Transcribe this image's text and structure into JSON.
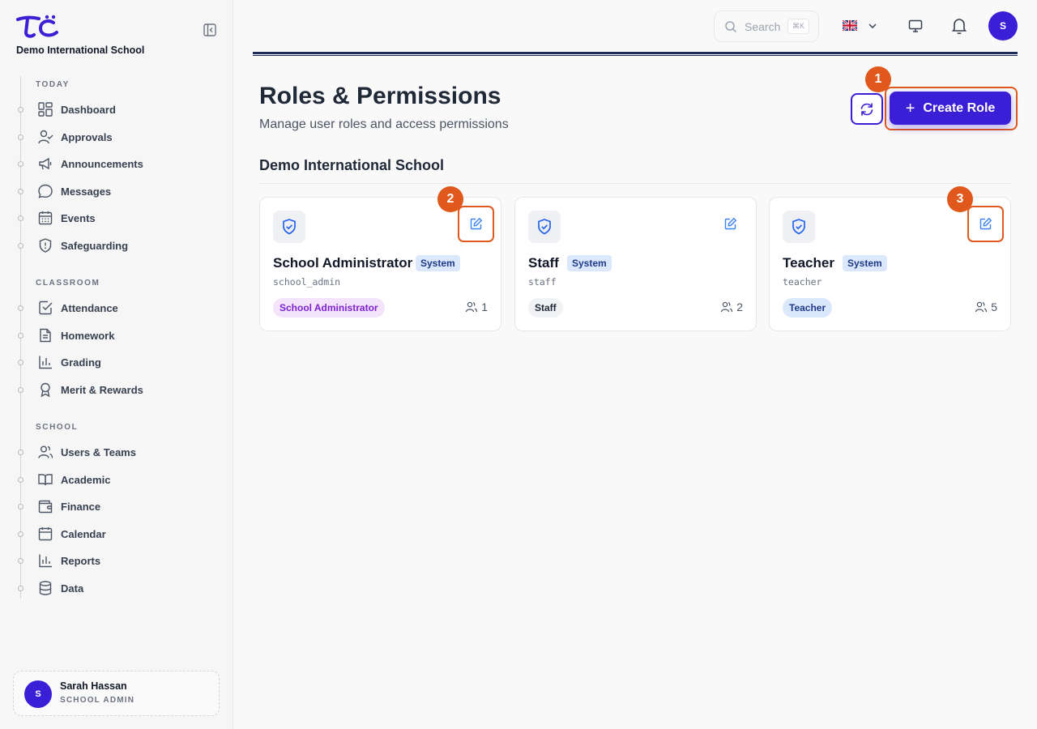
{
  "sidebar": {
    "school_name": "Demo International School",
    "sections": [
      {
        "label": "TODAY",
        "items": [
          {
            "label": "Dashboard",
            "icon": "dashboard-icon"
          },
          {
            "label": "Approvals",
            "icon": "user-check-icon"
          },
          {
            "label": "Announcements",
            "icon": "megaphone-icon"
          },
          {
            "label": "Messages",
            "icon": "chat-bubble-icon"
          },
          {
            "label": "Events",
            "icon": "calendar-grid-icon"
          },
          {
            "label": "Safeguarding",
            "icon": "shield-alert-icon"
          }
        ]
      },
      {
        "label": "CLASSROOM",
        "items": [
          {
            "label": "Attendance",
            "icon": "checkbox-icon"
          },
          {
            "label": "Homework",
            "icon": "document-icon"
          },
          {
            "label": "Grading",
            "icon": "bar-chart-icon"
          },
          {
            "label": "Merit & Rewards",
            "icon": "award-icon"
          }
        ]
      },
      {
        "label": "SCHOOL",
        "items": [
          {
            "label": "Users & Teams",
            "icon": "users-icon"
          },
          {
            "label": "Academic",
            "icon": "book-open-icon"
          },
          {
            "label": "Finance",
            "icon": "wallet-icon"
          },
          {
            "label": "Calendar",
            "icon": "calendar-icon"
          },
          {
            "label": "Reports",
            "icon": "bar-chart-icon"
          },
          {
            "label": "Data",
            "icon": "database-icon"
          }
        ]
      }
    ],
    "user": {
      "initial": "S",
      "name": "Sarah Hassan",
      "role": "SCHOOL ADMIN"
    }
  },
  "topbar": {
    "search_placeholder": "Search",
    "search_shortcut": "⌘K",
    "avatar_initial": "S"
  },
  "header": {
    "title": "Roles & Permissions",
    "subtitle": "Manage user roles and access permissions",
    "create_label": "Create Role"
  },
  "annotations": [
    "1",
    "2",
    "3"
  ],
  "group": {
    "title": "Demo International School",
    "roles": [
      {
        "name": "School Administrator",
        "tag": "System",
        "key": "school_admin",
        "pill": "School Administrator",
        "count": "1",
        "pill_bg": "#f3e3fb",
        "pill_color": "#7e22ce"
      },
      {
        "name": "Staff",
        "tag": "System",
        "key": "staff",
        "pill": "Staff",
        "count": "2",
        "pill_bg": "#f1f2f4",
        "pill_color": "#1f2937"
      },
      {
        "name": "Teacher",
        "tag": "System",
        "key": "teacher",
        "pill": "Teacher",
        "count": "5",
        "pill_bg": "#dbe7fb",
        "pill_color": "#1e3a8a"
      }
    ]
  },
  "colors": {
    "accent": "#3b1fd6",
    "highlight": "#e0581c"
  }
}
